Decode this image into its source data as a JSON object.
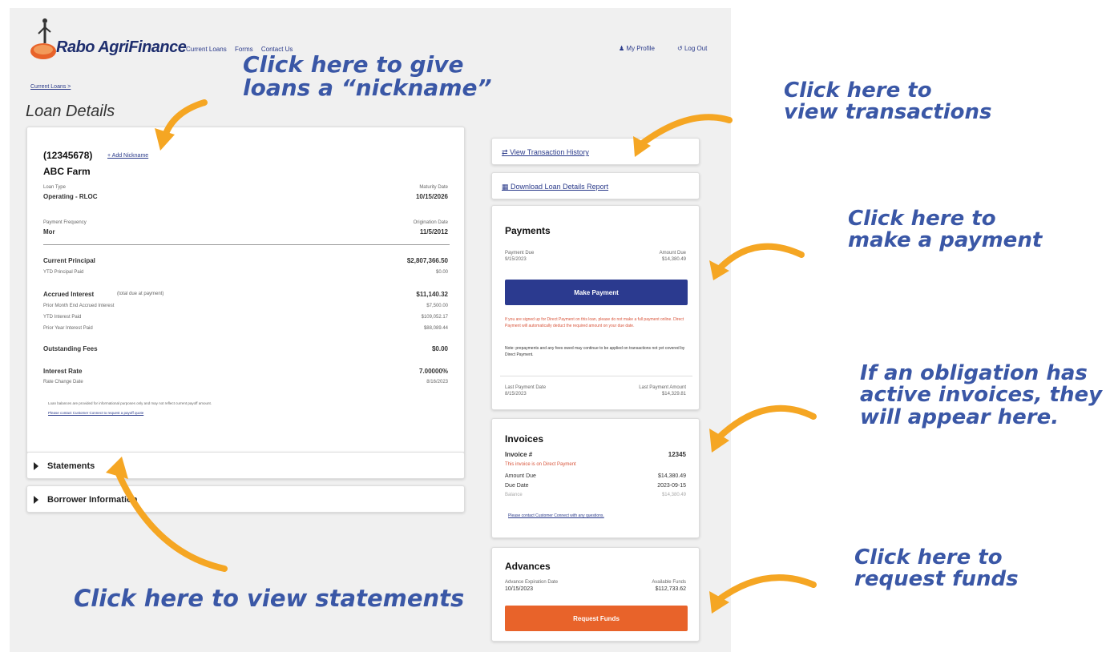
{
  "colors": {
    "brand_blue": "#1e2e6e",
    "link_blue": "#2a3a8a",
    "button_blue": "#2b3a8f",
    "button_orange": "#e8632a",
    "arrow_orange": "#f5a623",
    "annotation_blue": "#3a57a6",
    "warning_red": "#d8543a"
  },
  "header": {
    "brand": "Rabo AgriFinance",
    "nav": [
      "Current Loans",
      "Forms",
      "Contact Us"
    ],
    "profile": "My Profile",
    "profile_icon": "person-icon",
    "logout": "Log Out",
    "logout_icon": "logout-icon"
  },
  "breadcrumb": "Current Loans >",
  "page_title": "Loan Details",
  "loan": {
    "number": "(12345678)",
    "add_nickname": "+ Add Nickname",
    "farm": "ABC Farm",
    "loan_type_label": "Loan Type",
    "loan_type": "Operating - RLOC",
    "maturity_label": "Maturity Date",
    "maturity": "10/15/2026",
    "pay_freq_label": "Payment Frequency",
    "pay_freq": "Mor",
    "origination_label": "Origination Date",
    "origination": "11/5/2012",
    "current_principal_label": "Current Principal",
    "current_principal": "$2,807,366.50",
    "ytd_principal_label": "YTD Principal Paid",
    "ytd_principal": "$0.00",
    "accrued_interest_label": "Accrued Interest",
    "accrued_interest_note": "(total due at payment)",
    "accrued_interest": "$11,140.32",
    "prior_month_label": "Prior Month End Accrued Interest",
    "prior_month": "$7,500.00",
    "ytd_interest_label": "YTD Interest Paid",
    "ytd_interest": "$109,052.17",
    "prior_year_label": "Prior Year Interest Paid",
    "prior_year": "$88,089.44",
    "fees_label": "Outstanding Fees",
    "fees": "$0.00",
    "rate_label": "Interest Rate",
    "rate": "7.00000%",
    "rate_change_label": "Rate Change Date",
    "rate_change": "8/16/2023",
    "disclaimer": "Loan balances are provided for informational purposes only and may not reflect current payoff amount.",
    "contact_link": "Please contact Customer Connect to request a payoff quote"
  },
  "collapsibles": [
    "Statements",
    "Borrower Information"
  ],
  "right": {
    "transactions_link": "View Transaction History",
    "report_link": "Download Loan Details Report",
    "payments": {
      "title": "Payments",
      "due_label": "Payment Due",
      "due": "9/15/2023",
      "amount_label": "Amount Due",
      "amount": "$14,380.49",
      "button": "Make Payment",
      "warning": "If you are signed up for Direct Payment on this loan, please do not make a full payment online. Direct Payment will automatically deduct the required amount on your due date.",
      "note": "Note: prepayments and any fees owed may continue to be applied on transactions not yet covered by Direct Payment.",
      "last_date_label": "Last Payment Date",
      "last_date": "8/15/2023",
      "last_amount_label": "Last Payment Amount",
      "last_amount": "$14,329.81"
    },
    "invoices": {
      "title": "Invoices",
      "invoice_label": "Invoice #",
      "invoice": "12345",
      "direct_note": "This invoice is on Direct Payment",
      "amount_label": "Amount Due",
      "amount": "$14,380.49",
      "due_label": "Due Date",
      "due": "2023-09-15",
      "balance_label": "Balance",
      "balance": "$14,380.49",
      "link": "Please contact Customer Connect with any questions."
    },
    "advances": {
      "title": "Advances",
      "exp_label": "Advance Expiration Date",
      "exp": "10/15/2023",
      "avail_label": "Available Funds",
      "avail": "$112,733.62",
      "button": "Request Funds"
    }
  },
  "annotations": {
    "nickname": "Click here to give\nloans a “nickname”",
    "transactions": "Click here to\nview transactions",
    "payment": "Click here to\nmake a payment",
    "invoices": "If an obligation has\nactive invoices, they\nwill appear here.",
    "funds": "Click here to\nrequest funds",
    "statements": "Click here to view statements"
  }
}
